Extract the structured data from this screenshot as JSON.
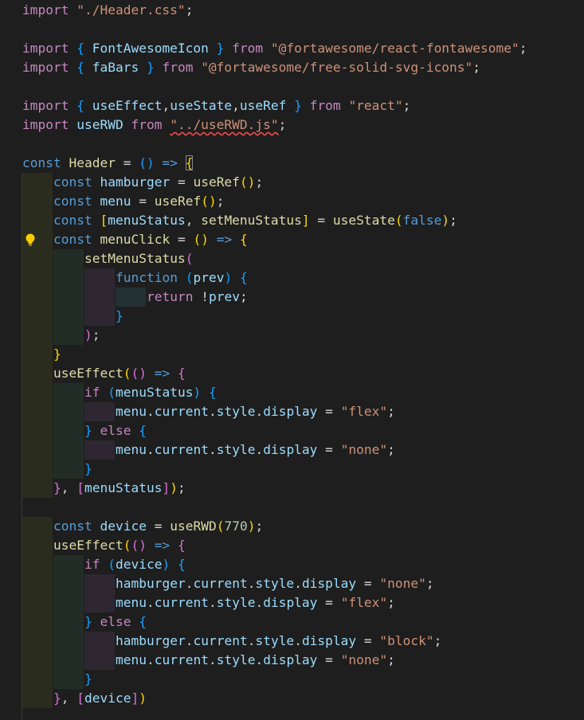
{
  "editor": {
    "theme": "dark",
    "colors": {
      "background": "#1e1e1e",
      "keyword_control": "#c586c0",
      "keyword_storage": "#569cd6",
      "variable": "#9cdcfe",
      "function": "#dcdcaa",
      "string": "#ce9178",
      "number": "#b5cea8",
      "punctuation": "#d4d4d4",
      "bracket_gold": "#ffd700",
      "bracket_purple": "#da70d6",
      "bracket_blue": "#179fff",
      "squiggle_error": "#f14c4c",
      "indent_level_1": "#2a2d1e",
      "indent_level_2": "#232d27",
      "indent_level_3": "#2e2731",
      "indent_level_4": "#233034"
    },
    "lightbulb_line": 12,
    "lines": [
      {
        "indent": 0,
        "tokens": [
          [
            "import",
            "kw"
          ],
          [
            " ",
            "p"
          ],
          [
            "\"./Header.css\"",
            "str"
          ],
          [
            ";",
            "p"
          ]
        ]
      },
      {
        "indent": 0,
        "tokens": []
      },
      {
        "indent": 0,
        "tokens": [
          [
            "import",
            "kw"
          ],
          [
            " ",
            "p"
          ],
          [
            "{",
            "bb"
          ],
          [
            " FontAwesomeIcon ",
            "var"
          ],
          [
            "}",
            "bb"
          ],
          [
            " ",
            "p"
          ],
          [
            "from",
            "kw"
          ],
          [
            " ",
            "p"
          ],
          [
            "\"@fortawesome/react-fontawesome\"",
            "str"
          ],
          [
            ";",
            "p"
          ]
        ]
      },
      {
        "indent": 0,
        "tokens": [
          [
            "import",
            "kw"
          ],
          [
            " ",
            "p"
          ],
          [
            "{",
            "bb"
          ],
          [
            " faBars ",
            "var"
          ],
          [
            "}",
            "bb"
          ],
          [
            " ",
            "p"
          ],
          [
            "from",
            "kw"
          ],
          [
            " ",
            "p"
          ],
          [
            "\"@fortawesome/free-solid-svg-icons\"",
            "str"
          ],
          [
            ";",
            "p"
          ]
        ]
      },
      {
        "indent": 0,
        "tokens": []
      },
      {
        "indent": 0,
        "tokens": [
          [
            "import",
            "kw"
          ],
          [
            " ",
            "p"
          ],
          [
            "{",
            "bb"
          ],
          [
            " useEffect",
            "var"
          ],
          [
            ",",
            "p"
          ],
          [
            "useState",
            "var"
          ],
          [
            ",",
            "p"
          ],
          [
            "useRef ",
            "var"
          ],
          [
            "}",
            "bb"
          ],
          [
            " ",
            "p"
          ],
          [
            "from",
            "kw"
          ],
          [
            " ",
            "p"
          ],
          [
            "\"react\"",
            "str"
          ],
          [
            ";",
            "p"
          ]
        ]
      },
      {
        "indent": 0,
        "tokens": [
          [
            "import",
            "kw"
          ],
          [
            " ",
            "p"
          ],
          [
            "useRWD",
            "var"
          ],
          [
            " ",
            "p"
          ],
          [
            "from",
            "kw"
          ],
          [
            " ",
            "p"
          ],
          [
            "\"../useRWD.js\"",
            "strerr"
          ],
          [
            ";",
            "p"
          ]
        ]
      },
      {
        "indent": 0,
        "tokens": []
      },
      {
        "indent": 0,
        "tokens": [
          [
            "const",
            "st"
          ],
          [
            " ",
            "p"
          ],
          [
            "Header",
            "fn"
          ],
          [
            " = ",
            "p"
          ],
          [
            "()",
            "bb"
          ],
          [
            " ",
            "p"
          ],
          [
            "=>",
            "st"
          ],
          [
            " ",
            "p"
          ],
          [
            "{",
            "bgbox"
          ]
        ]
      },
      {
        "indent": 1,
        "tokens": [
          [
            "const",
            "st"
          ],
          [
            " ",
            "p"
          ],
          [
            "hamburger",
            "var"
          ],
          [
            " = ",
            "p"
          ],
          [
            "useRef",
            "fn"
          ],
          [
            "()",
            "bg"
          ],
          [
            ";",
            "p"
          ]
        ]
      },
      {
        "indent": 1,
        "tokens": [
          [
            "const",
            "st"
          ],
          [
            " ",
            "p"
          ],
          [
            "menu",
            "var"
          ],
          [
            " = ",
            "p"
          ],
          [
            "useRef",
            "fn"
          ],
          [
            "()",
            "bg"
          ],
          [
            ";",
            "p"
          ]
        ]
      },
      {
        "indent": 1,
        "tokens": [
          [
            "const",
            "st"
          ],
          [
            " ",
            "p"
          ],
          [
            "[",
            "bg"
          ],
          [
            "menuStatus",
            "var"
          ],
          [
            ", ",
            "p"
          ],
          [
            "setMenuStatus",
            "fn"
          ],
          [
            "]",
            "bg"
          ],
          [
            " = ",
            "p"
          ],
          [
            "useState",
            "fn"
          ],
          [
            "(",
            "bg"
          ],
          [
            "false",
            "st"
          ],
          [
            ")",
            "bg"
          ],
          [
            ";",
            "p"
          ]
        ]
      },
      {
        "indent": 1,
        "tokens": [
          [
            "const",
            "st"
          ],
          [
            " ",
            "p"
          ],
          [
            "menuClick",
            "fn"
          ],
          [
            " = ",
            "p"
          ],
          [
            "()",
            "bg"
          ],
          [
            " ",
            "p"
          ],
          [
            "=>",
            "st"
          ],
          [
            " ",
            "p"
          ],
          [
            "{",
            "bg"
          ]
        ]
      },
      {
        "indent": 2,
        "tokens": [
          [
            "setMenuStatus",
            "fn"
          ],
          [
            "(",
            "bp"
          ]
        ]
      },
      {
        "indent": 3,
        "tokens": [
          [
            "function",
            "st"
          ],
          [
            " ",
            "p"
          ],
          [
            "(",
            "bb"
          ],
          [
            "prev",
            "var"
          ],
          [
            ")",
            "bb"
          ],
          [
            " ",
            "p"
          ],
          [
            "{",
            "bb"
          ]
        ]
      },
      {
        "indent": 4,
        "tokens": [
          [
            "return",
            "kw"
          ],
          [
            " !",
            "p"
          ],
          [
            "prev",
            "var"
          ],
          [
            ";",
            "p"
          ]
        ]
      },
      {
        "indent": 3,
        "tokens": [
          [
            "}",
            "bb"
          ]
        ]
      },
      {
        "indent": 2,
        "tokens": [
          [
            ")",
            "bp"
          ],
          [
            ";",
            "p"
          ]
        ]
      },
      {
        "indent": 1,
        "tokens": [
          [
            "}",
            "bg"
          ]
        ]
      },
      {
        "indent": 1,
        "tokens": [
          [
            "useEffect",
            "fn"
          ],
          [
            "(",
            "bg"
          ],
          [
            "()",
            "bp"
          ],
          [
            " ",
            "p"
          ],
          [
            "=>",
            "st"
          ],
          [
            " ",
            "p"
          ],
          [
            "{",
            "bp"
          ]
        ]
      },
      {
        "indent": 2,
        "tokens": [
          [
            "if",
            "kw"
          ],
          [
            " ",
            "p"
          ],
          [
            "(",
            "bb"
          ],
          [
            "menuStatus",
            "var"
          ],
          [
            ")",
            "bb"
          ],
          [
            " ",
            "p"
          ],
          [
            "{",
            "bb"
          ]
        ]
      },
      {
        "indent": 3,
        "tokens": [
          [
            "menu",
            "var"
          ],
          [
            ".",
            "p"
          ],
          [
            "current",
            "var"
          ],
          [
            ".",
            "p"
          ],
          [
            "style",
            "var"
          ],
          [
            ".",
            "p"
          ],
          [
            "display",
            "var"
          ],
          [
            " = ",
            "p"
          ],
          [
            "\"flex\"",
            "str"
          ],
          [
            ";",
            "p"
          ]
        ]
      },
      {
        "indent": 2,
        "tokens": [
          [
            "}",
            "bb"
          ],
          [
            " ",
            "p"
          ],
          [
            "else",
            "kw"
          ],
          [
            " ",
            "p"
          ],
          [
            "{",
            "bb"
          ]
        ]
      },
      {
        "indent": 3,
        "tokens": [
          [
            "menu",
            "var"
          ],
          [
            ".",
            "p"
          ],
          [
            "current",
            "var"
          ],
          [
            ".",
            "p"
          ],
          [
            "style",
            "var"
          ],
          [
            ".",
            "p"
          ],
          [
            "display",
            "var"
          ],
          [
            " = ",
            "p"
          ],
          [
            "\"none\"",
            "str"
          ],
          [
            ";",
            "p"
          ]
        ]
      },
      {
        "indent": 2,
        "tokens": [
          [
            "}",
            "bb"
          ]
        ]
      },
      {
        "indent": 1,
        "tokens": [
          [
            "}",
            "bp"
          ],
          [
            ", ",
            "p"
          ],
          [
            "[",
            "bp"
          ],
          [
            "menuStatus",
            "var"
          ],
          [
            "]",
            "bp"
          ],
          [
            ")",
            "bg"
          ],
          [
            ";",
            "p"
          ]
        ]
      },
      {
        "indent": 0,
        "tokens": []
      },
      {
        "indent": 1,
        "tokens": [
          [
            "const",
            "st"
          ],
          [
            " ",
            "p"
          ],
          [
            "device",
            "var"
          ],
          [
            " = ",
            "p"
          ],
          [
            "useRWD",
            "fn"
          ],
          [
            "(",
            "bg"
          ],
          [
            "770",
            "num"
          ],
          [
            ")",
            "bg"
          ],
          [
            ";",
            "p"
          ]
        ]
      },
      {
        "indent": 1,
        "tokens": [
          [
            "useEffect",
            "fn"
          ],
          [
            "(",
            "bg"
          ],
          [
            "()",
            "bp"
          ],
          [
            " ",
            "p"
          ],
          [
            "=>",
            "st"
          ],
          [
            " ",
            "p"
          ],
          [
            "{",
            "bp"
          ]
        ]
      },
      {
        "indent": 2,
        "tokens": [
          [
            "if",
            "kw"
          ],
          [
            " ",
            "p"
          ],
          [
            "(",
            "bb"
          ],
          [
            "device",
            "var"
          ],
          [
            ")",
            "bb"
          ],
          [
            " ",
            "p"
          ],
          [
            "{",
            "bb"
          ]
        ]
      },
      {
        "indent": 3,
        "tokens": [
          [
            "hamburger",
            "var"
          ],
          [
            ".",
            "p"
          ],
          [
            "current",
            "var"
          ],
          [
            ".",
            "p"
          ],
          [
            "style",
            "var"
          ],
          [
            ".",
            "p"
          ],
          [
            "display",
            "var"
          ],
          [
            " = ",
            "p"
          ],
          [
            "\"none\"",
            "str"
          ],
          [
            ";",
            "p"
          ]
        ]
      },
      {
        "indent": 3,
        "tokens": [
          [
            "menu",
            "var"
          ],
          [
            ".",
            "p"
          ],
          [
            "current",
            "var"
          ],
          [
            ".",
            "p"
          ],
          [
            "style",
            "var"
          ],
          [
            ".",
            "p"
          ],
          [
            "display",
            "var"
          ],
          [
            " = ",
            "p"
          ],
          [
            "\"flex\"",
            "str"
          ],
          [
            ";",
            "p"
          ]
        ]
      },
      {
        "indent": 2,
        "tokens": [
          [
            "}",
            "bb"
          ],
          [
            " ",
            "p"
          ],
          [
            "else",
            "kw"
          ],
          [
            " ",
            "p"
          ],
          [
            "{",
            "bb"
          ]
        ]
      },
      {
        "indent": 3,
        "tokens": [
          [
            "hamburger",
            "var"
          ],
          [
            ".",
            "p"
          ],
          [
            "current",
            "var"
          ],
          [
            ".",
            "p"
          ],
          [
            "style",
            "var"
          ],
          [
            ".",
            "p"
          ],
          [
            "display",
            "var"
          ],
          [
            " = ",
            "p"
          ],
          [
            "\"block\"",
            "str"
          ],
          [
            ";",
            "p"
          ]
        ]
      },
      {
        "indent": 3,
        "tokens": [
          [
            "menu",
            "var"
          ],
          [
            ".",
            "p"
          ],
          [
            "current",
            "var"
          ],
          [
            ".",
            "p"
          ],
          [
            "style",
            "var"
          ],
          [
            ".",
            "p"
          ],
          [
            "display",
            "var"
          ],
          [
            " = ",
            "p"
          ],
          [
            "\"none\"",
            "str"
          ],
          [
            ";",
            "p"
          ]
        ]
      },
      {
        "indent": 2,
        "tokens": [
          [
            "}",
            "bb"
          ]
        ]
      },
      {
        "indent": 1,
        "tokens": [
          [
            "}",
            "bp"
          ],
          [
            ", ",
            "p"
          ],
          [
            "[",
            "bp"
          ],
          [
            "device",
            "var"
          ],
          [
            "]",
            "bp"
          ],
          [
            ")",
            "bg"
          ]
        ]
      },
      {
        "indent": 0,
        "tokens": []
      }
    ]
  }
}
